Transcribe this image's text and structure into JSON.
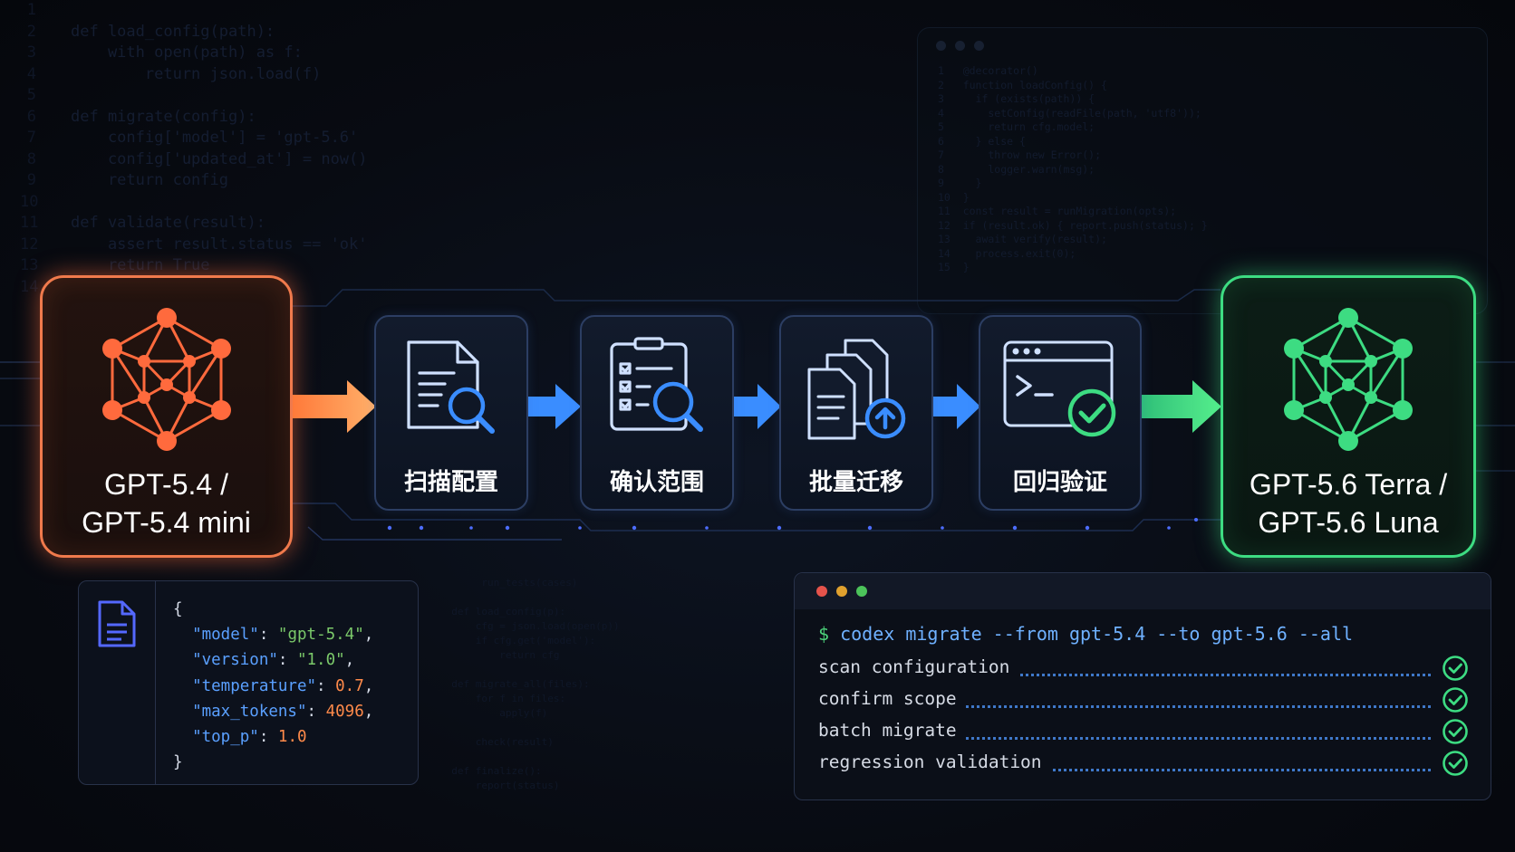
{
  "source_model": {
    "line1": "GPT-5.4 /",
    "line2": "GPT-5.4 mini"
  },
  "target_model": {
    "line1": "GPT-5.6 Terra /",
    "line2": "GPT-5.6 Luna"
  },
  "steps": [
    {
      "label": "扫描配置",
      "icon": "document-search-icon"
    },
    {
      "label": "确认范围",
      "icon": "checklist-search-icon"
    },
    {
      "label": "批量迁移",
      "icon": "files-upload-icon"
    },
    {
      "label": "回归验证",
      "icon": "terminal-check-icon"
    }
  ],
  "colors": {
    "source": "#f07a4c",
    "target": "#3ddc82",
    "flow": "#3a8dff",
    "check": "#3ddc82"
  },
  "config_file": {
    "open_brace": "{",
    "close_brace": "}",
    "entries": [
      {
        "key": "\"model\"",
        "value": "\"gpt-5.4\"",
        "type": "string",
        "comma": ","
      },
      {
        "key": "\"version\"",
        "value": "\"1.0\"",
        "type": "string",
        "comma": ","
      },
      {
        "key": "\"temperature\"",
        "value": "0.7",
        "type": "number",
        "comma": ","
      },
      {
        "key": "\"max_tokens\"",
        "value": "4096",
        "type": "number",
        "comma": ","
      },
      {
        "key": "\"top_p\"",
        "value": "1.0",
        "type": "number",
        "comma": ""
      }
    ]
  },
  "terminal": {
    "prompt": "$",
    "command": "codex migrate --from gpt-5.4 --to gpt-5.6 --all",
    "tasks": [
      {
        "label": "scan configuration",
        "status": "done"
      },
      {
        "label": "confirm scope",
        "status": "done"
      },
      {
        "label": "batch migrate",
        "status": "done"
      },
      {
        "label": "regression validation",
        "status": "done"
      }
    ]
  },
  "background_code": {
    "line_numbers": [
      "1",
      "2",
      "3",
      "4",
      "5",
      "6",
      "7",
      "8",
      "9",
      "10",
      "11",
      "12",
      "13",
      "14"
    ],
    "lines": [
      "",
      "def load_config(path):",
      "    with open(path) as f:",
      "        return json.load(f)",
      "",
      "def migrate(config):",
      "    config['model'] = 'gpt-5.6'",
      "    config['updated_at'] = now()",
      "    return config",
      "",
      "def validate(result):",
      "    assert result.status == 'ok'",
      "    return True",
      ""
    ]
  }
}
